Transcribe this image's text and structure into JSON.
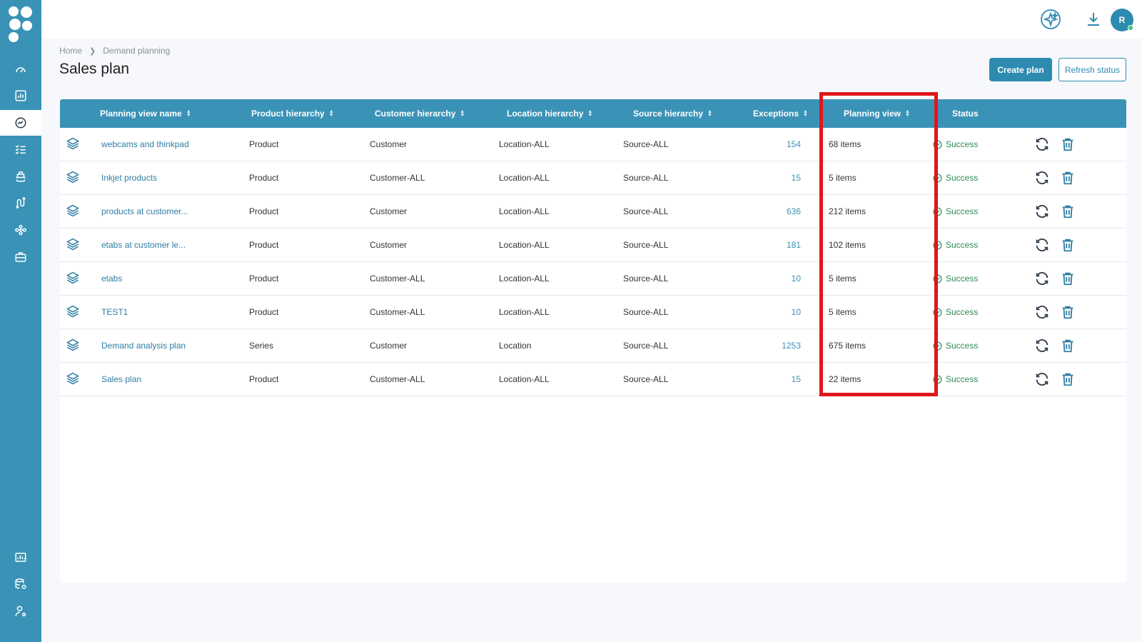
{
  "app": {
    "user_initial": "R"
  },
  "sidebar": {
    "items": [
      {
        "icon": "speedometer-icon",
        "active": false
      },
      {
        "icon": "bar-chart-icon",
        "active": false
      },
      {
        "icon": "trend-icon",
        "active": true
      },
      {
        "icon": "checklist-icon",
        "active": false
      },
      {
        "icon": "ship-icon",
        "active": false
      },
      {
        "icon": "route-icon",
        "active": false
      },
      {
        "icon": "network-icon",
        "active": false
      },
      {
        "icon": "briefcase-icon",
        "active": false
      }
    ],
    "bottom_items": [
      {
        "icon": "dashboard-icon"
      },
      {
        "icon": "database-settings-icon"
      },
      {
        "icon": "user-settings-icon"
      }
    ]
  },
  "breadcrumb": {
    "home": "Home",
    "current": "Demand planning"
  },
  "page": {
    "title": "Sales plan",
    "create_button": "Create plan",
    "refresh_button": "Refresh status"
  },
  "table": {
    "headers": {
      "name": "Planning view name",
      "product": "Product hierarchy",
      "customer": "Customer hierarchy",
      "location": "Location hierarchy",
      "source": "Source hierarchy",
      "exceptions": "Exceptions",
      "planning_view": "Planning view",
      "status": "Status"
    },
    "rows": [
      {
        "name": "webcams and thinkpad",
        "product": "Product",
        "customer": "Customer",
        "location": "Location-ALL",
        "source": "Source-ALL",
        "exceptions": "154",
        "planning_view": "68 items",
        "status": "Success"
      },
      {
        "name": "Inkjet products",
        "product": "Product",
        "customer": "Customer-ALL",
        "location": "Location-ALL",
        "source": "Source-ALL",
        "exceptions": "15",
        "planning_view": "5 items",
        "status": "Success"
      },
      {
        "name": "products at customer...",
        "product": "Product",
        "customer": "Customer",
        "location": "Location-ALL",
        "source": "Source-ALL",
        "exceptions": "636",
        "planning_view": "212 items",
        "status": "Success"
      },
      {
        "name": "etabs at customer le...",
        "product": "Product",
        "customer": "Customer",
        "location": "Location-ALL",
        "source": "Source-ALL",
        "exceptions": "181",
        "planning_view": "102 items",
        "status": "Success"
      },
      {
        "name": "etabs",
        "product": "Product",
        "customer": "Customer-ALL",
        "location": "Location-ALL",
        "source": "Source-ALL",
        "exceptions": "10",
        "planning_view": "5 items",
        "status": "Success"
      },
      {
        "name": "TEST1",
        "product": "Product",
        "customer": "Customer-ALL",
        "location": "Location-ALL",
        "source": "Source-ALL",
        "exceptions": "10",
        "planning_view": "5 items",
        "status": "Success"
      },
      {
        "name": "Demand analysis plan",
        "product": "Series",
        "customer": "Customer",
        "location": "Location",
        "source": "Source-ALL",
        "exceptions": "1253",
        "planning_view": "675 items",
        "status": "Success"
      },
      {
        "name": "Sales plan",
        "product": "Product",
        "customer": "Customer-ALL",
        "location": "Location-ALL",
        "source": "Source-ALL",
        "exceptions": "15",
        "planning_view": "22 items",
        "status": "Success"
      }
    ]
  },
  "colors": {
    "brand": "#3a93b6",
    "primary_button": "#2e8bb0",
    "success": "#2e8b57",
    "highlight": "#e0161b"
  }
}
